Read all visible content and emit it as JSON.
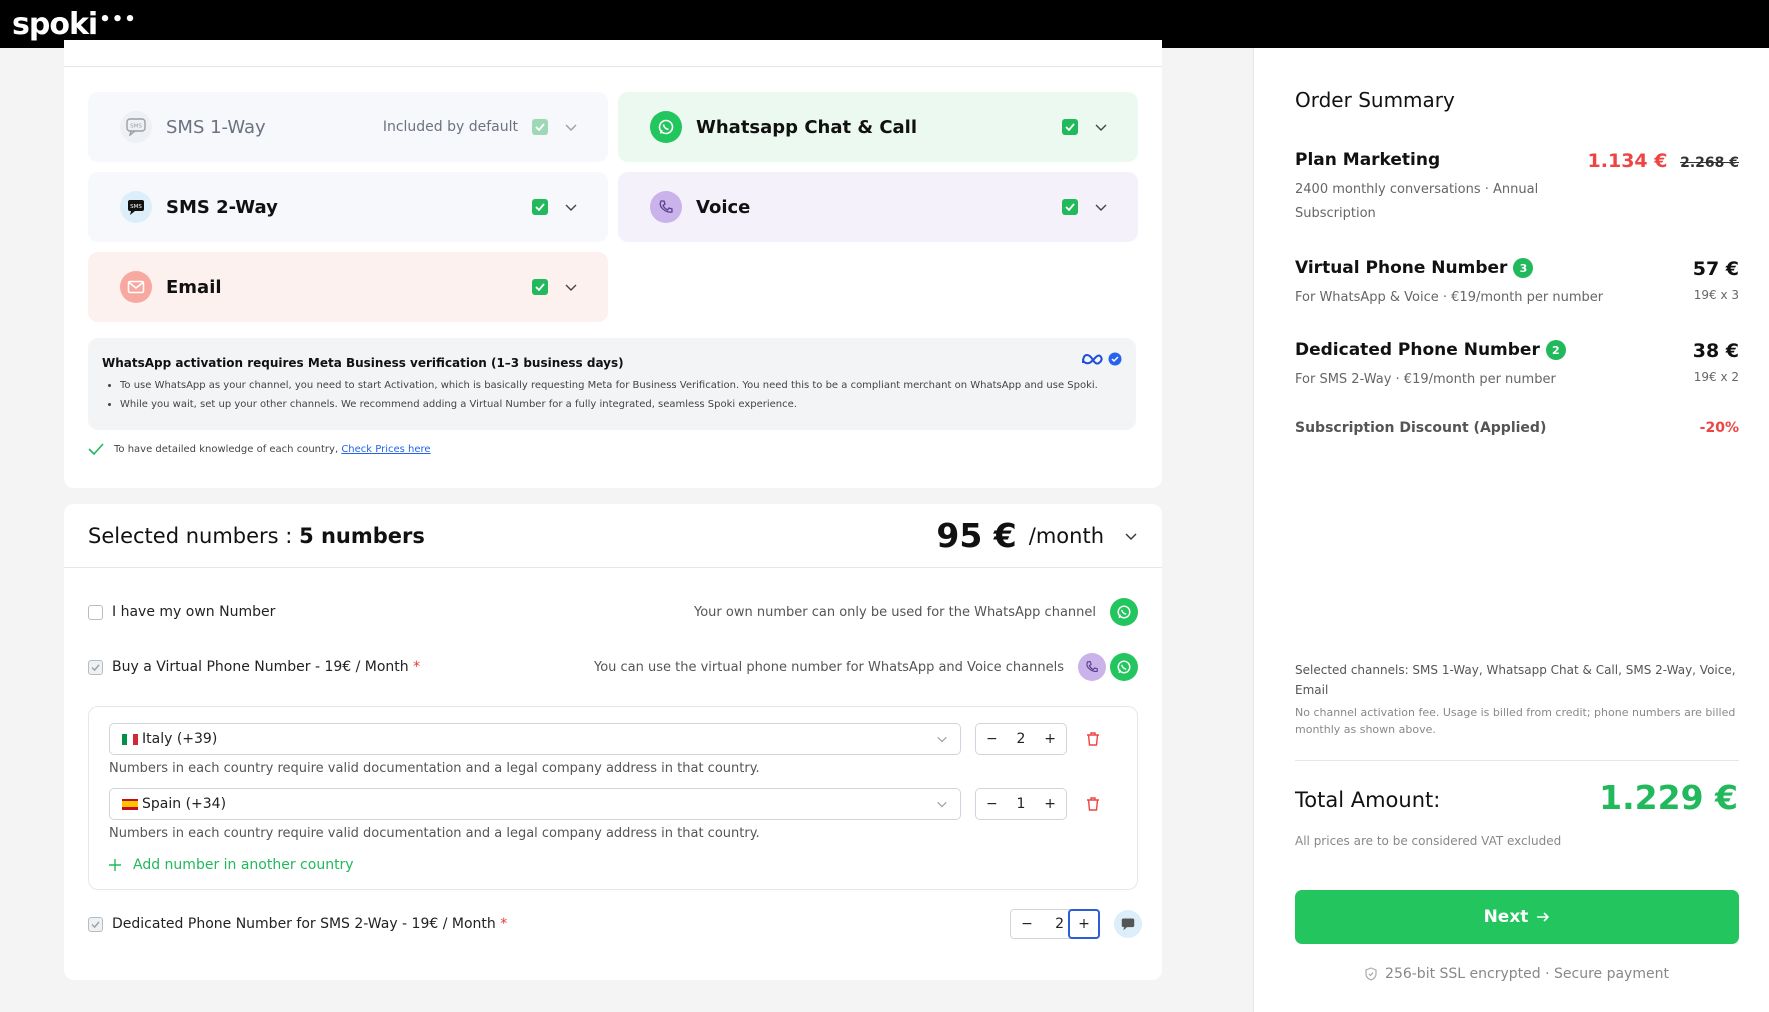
{
  "app": {
    "logo_text": "spoki",
    "logo_dots": "•••"
  },
  "channels": [
    {
      "label": "SMS 1-Way",
      "note": "Included by default",
      "icon": "sms-icon",
      "checked": true,
      "bg": "#f6f8fb"
    },
    {
      "label": "Whatsapp Chat & Call",
      "note": "",
      "icon": "whatsapp-icon",
      "checked": true,
      "bg": "#ecf9f0"
    },
    {
      "label": "SMS 2-Way",
      "note": "",
      "icon": "sms-chat-icon",
      "checked": true,
      "bg": "#f6f8fb"
    },
    {
      "label": "Voice",
      "note": "",
      "icon": "phone-icon",
      "checked": true,
      "bg": "#f4f1fa"
    },
    {
      "label": "Email",
      "note": "",
      "icon": "email-icon",
      "checked": true,
      "bg": "#fdf1f0"
    }
  ],
  "notice": {
    "title": "WhatsApp activation requires Meta Business verification (1–3 business days)",
    "bullets": [
      "To use WhatsApp as your channel, you need to start Activation, which is basically requesting Meta for Business Verification. You need this to be a compliant merchant on WhatsApp and use Spoki.",
      "While you wait, set up your other channels. We recommend adding a Virtual Number for a fully integrated, seamless Spoki experience."
    ]
  },
  "prices_line": {
    "text": "To have detailed knowledge of each country,",
    "link": "Check Prices here"
  },
  "selected": {
    "title_prefix": "Selected numbers :",
    "title_count": "5 numbers",
    "price": "95 €",
    "per": "/month"
  },
  "own_number": {
    "label": "I have my own Number",
    "hint": "Your own number can only be used for the WhatsApp channel",
    "checked": false
  },
  "virtual_number": {
    "label": "Buy a Virtual Phone Number - 19€ / Month",
    "required_mark": "*",
    "hint": "You can use the virtual phone number for WhatsApp and Voice channels",
    "checked": true
  },
  "countries": [
    {
      "name": "Italy (+39)",
      "qty": "2",
      "hint": "Numbers in each country require valid documentation and a legal company address in that country."
    },
    {
      "name": "Spain (+34)",
      "qty": "1",
      "hint": "Numbers in each country require valid documentation and a legal company address in that country."
    }
  ],
  "add_country": "Add number in another country",
  "dedicated": {
    "label": "Dedicated Phone Number for SMS 2-Way - 19€ / Month",
    "required_mark": "*",
    "qty": "2",
    "checked": true
  },
  "stepper": {
    "minus": "−",
    "plus": "+"
  },
  "summary": {
    "title": "Order Summary",
    "plan": {
      "name": "Plan Marketing",
      "price": "1.134 €",
      "old_price": "2.268 €",
      "sub": "2400 monthly conversations · Annual Subscription"
    },
    "virtual": {
      "name": "Virtual Phone Number",
      "badge": "3",
      "price": "57 €",
      "unit": "19€ x 3",
      "sub": "For WhatsApp & Voice · €19/month per number"
    },
    "dedicated": {
      "name": "Dedicated Phone Number",
      "badge": "2",
      "price": "38 €",
      "unit": "19€ x 2",
      "sub": "For SMS 2-Way · €19/month per number"
    },
    "discount": {
      "label": "Subscription Discount (Applied)",
      "value": "-20%"
    },
    "selected_channels": "Selected channels: SMS 1-Way, Whatsapp Chat & Call, SMS 2-Way, Voice, Email",
    "note": "No channel activation fee. Usage is billed from credit; phone numbers are billed monthly as shown above.",
    "total_label": "Total Amount:",
    "total_value": "1.229 €",
    "vat": "All prices are to be considered VAT excluded",
    "next": "Next",
    "ssl": "256-bit SSL encrypted · Secure payment"
  },
  "colors": {
    "green": "#22c55e",
    "red": "#ef4444",
    "blue_link": "#2563eb"
  }
}
